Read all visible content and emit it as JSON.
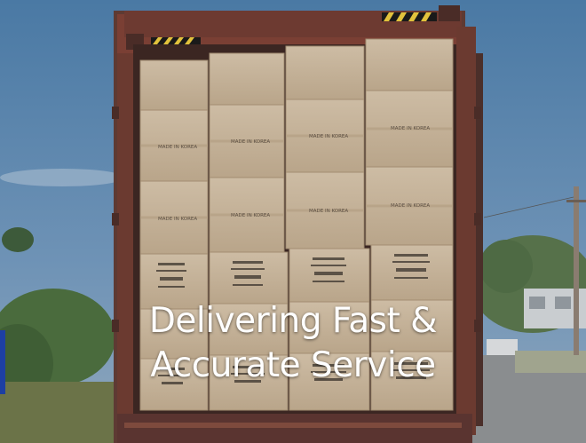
{
  "hero": {
    "headline_line1": "Delivering Fast &",
    "headline_line2": "Accurate Service",
    "box_label": "MADE IN KOREA"
  },
  "colors": {
    "sky": "#3f6f9b",
    "container": "#7a3f34",
    "carton": "#c7b49b",
    "headline": "#ffffff"
  }
}
